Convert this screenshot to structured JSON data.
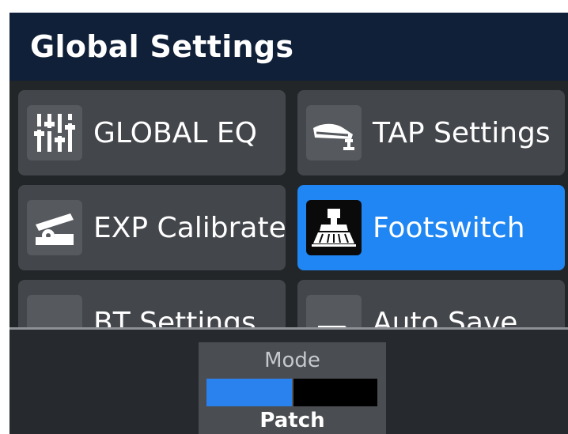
{
  "header": {
    "title": "Global Settings"
  },
  "tiles": [
    {
      "label": "GLOBAL EQ",
      "icon": "eq-sliders-icon",
      "selected": false
    },
    {
      "label": "TAP Settings",
      "icon": "tap-pedal-icon",
      "selected": false
    },
    {
      "label": "EXP Calibrate",
      "icon": "expression-pedal-icon",
      "selected": false
    },
    {
      "label": "Footswitch",
      "icon": "footswitch-icon",
      "selected": true
    },
    {
      "label": "BT Settings",
      "icon": "bluetooth-icon",
      "selected": false
    },
    {
      "label": "Auto Save",
      "icon": "save-icon",
      "selected": false
    }
  ],
  "mode": {
    "title": "Mode",
    "value": "Patch",
    "level": 0.5
  },
  "colors": {
    "accent": "#1f86f3",
    "header": "#102038",
    "tile": "#43464b"
  }
}
